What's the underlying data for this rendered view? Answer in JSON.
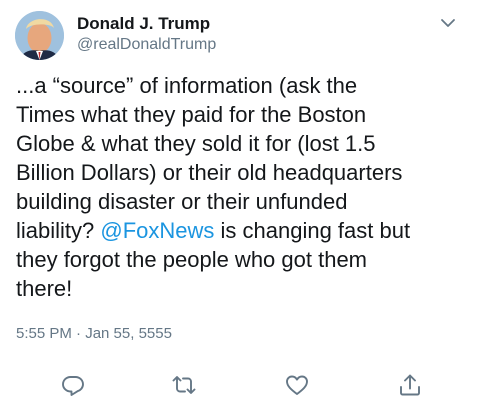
{
  "author": {
    "name": "Donald J. Trump",
    "handle": "@realDonaldTrump"
  },
  "tweet": {
    "text_before": "...a “source” of information (ask the\nTimes what they paid for the Boston\nGlobe & what they sold it for (lost 1.5\nBillion Dollars) or their old headquarters\nbuilding disaster or their unfunded\nliability? ",
    "mention": "@FoxNews",
    "text_after": " is changing fast but\nthey forgot the people who got them\nthere!",
    "timestamp": "5:55 PM · Jan 55, 5555"
  },
  "actions": [
    {
      "name": "reply",
      "icon": "reply-icon"
    },
    {
      "name": "retweet",
      "icon": "retweet-icon"
    },
    {
      "name": "like",
      "icon": "heart-icon"
    },
    {
      "name": "share",
      "icon": "share-icon"
    }
  ],
  "colors": {
    "text": "#14171a",
    "secondary": "#657786",
    "link": "#1b95e0",
    "icon": "#657786"
  }
}
